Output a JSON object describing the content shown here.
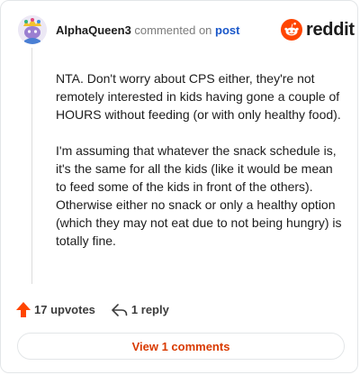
{
  "header": {
    "username": "AlphaQueen3",
    "action_text": "commented on",
    "post_link": "post"
  },
  "logo": {
    "wordmark": "reddit",
    "icon": "reddit-snoo-icon",
    "brand_color": "#ff4500"
  },
  "comment": {
    "paragraphs": [
      "NTA. Don't worry about CPS either, they're not remotely interested in kids having gone a couple of HOURS without feeding (or with only healthy food).",
      "I'm assuming that whatever the snack schedule is, it's the same for all the kids (like it would be mean to feed some of the kids in front of the others). Otherwise either no snack or only a healthy option (which they may not eat due to not being hungry) is totally fine."
    ]
  },
  "actions": {
    "upvotes": "17 upvotes",
    "replies": "1 reply",
    "upvote_icon": "upvote-arrow-icon",
    "reply_icon": "reply-arrow-icon",
    "upvote_color": "#ff4500"
  },
  "footer": {
    "view_comments": "View 1 comments",
    "accent": "#d93a00"
  }
}
